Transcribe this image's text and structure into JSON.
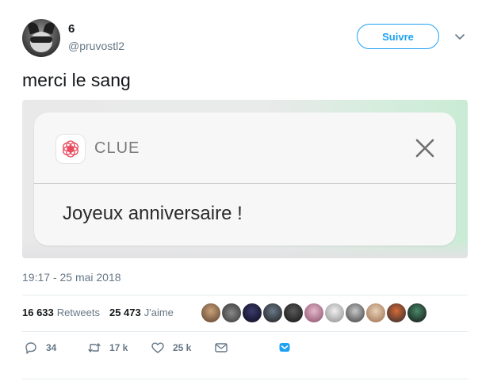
{
  "user": {
    "name": "6",
    "handle": "@pruvostl2"
  },
  "follow_label": "Suivre",
  "tweet": {
    "text": "merci le sang"
  },
  "notification": {
    "app_name": "CLUE",
    "message": "Joyeux anniversaire !"
  },
  "timestamp": "19:17 - 25 mai 2018",
  "stats": {
    "retweets_count": "16 633",
    "retweets_label": "Retweets",
    "likes_count": "25 473",
    "likes_label": "J'aime"
  },
  "actions": {
    "replies": "34",
    "retweets": "17 k",
    "likes": "25 k"
  },
  "colors": {
    "accent": "#1da1f2",
    "muted": "#657786",
    "clue_red": "#e8455a"
  },
  "icons": [
    "chevron-down-icon",
    "clue-logo-icon",
    "close-icon",
    "reply-icon",
    "retweet-icon",
    "like-icon",
    "message-icon",
    "save-icon"
  ]
}
